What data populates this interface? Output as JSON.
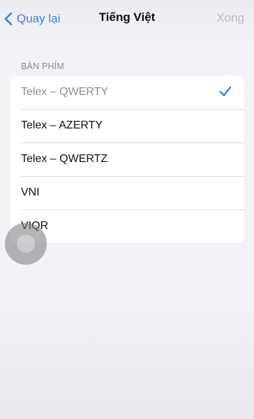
{
  "navbar": {
    "back_label": "Quay lại",
    "title": "Tiếng Việt",
    "done_label": "Xong"
  },
  "section": {
    "header": "BÀN PHÍM"
  },
  "keyboards": [
    {
      "label": "Telex – QWERTY",
      "selected": true
    },
    {
      "label": "Telex – AZERTY",
      "selected": false
    },
    {
      "label": "Telex – QWERTZ",
      "selected": false
    },
    {
      "label": "VNI",
      "selected": false
    },
    {
      "label": "VIQR",
      "selected": false
    }
  ],
  "colors": {
    "accent": "#3b82d8",
    "disabled": "#b8b8bd"
  },
  "icons": {
    "back": "chevron-left-icon",
    "selected": "checkmark-icon",
    "touch": "assistive-touch-icon"
  }
}
